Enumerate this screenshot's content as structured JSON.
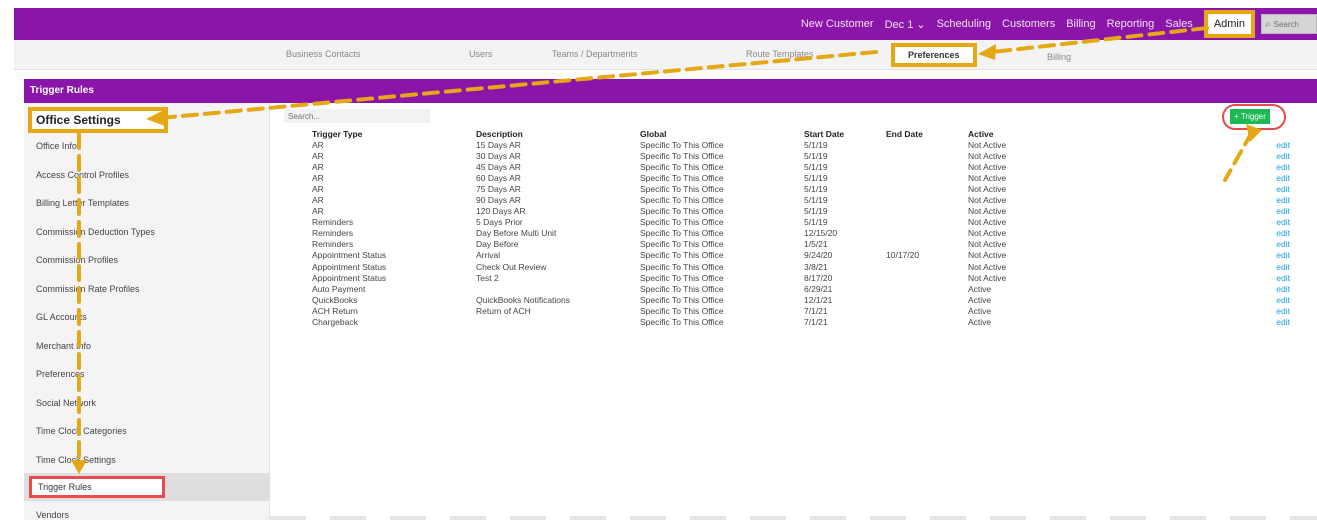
{
  "topnav": {
    "items": [
      "New Customer",
      "Dec 1 ⌄",
      "Scheduling",
      "Customers",
      "Billing",
      "Reporting",
      "Sales"
    ],
    "admin_label": "Admin",
    "search_placeholder": "Search"
  },
  "subnav": {
    "items": [
      "Business Contacts",
      "Users",
      "Teams / Departments",
      "Route Templates",
      "Billing"
    ],
    "active": "Preferences"
  },
  "panel": {
    "title": "Trigger Rules"
  },
  "sidebar": {
    "title": "Office Settings",
    "items": [
      "Office Info",
      "Access Control Profiles",
      "Billing Letter Templates",
      "Commission Deduction Types",
      "Commission Profiles",
      "Commission Rate Profiles",
      "GL Accounts",
      "Merchant Info",
      "Preferences",
      "Social Network",
      "Time Clock Categories",
      "Time Clock Settings"
    ],
    "active_item": "Trigger Rules",
    "after_item": "Vendors"
  },
  "search": {
    "placeholder": "Search..."
  },
  "add_button": {
    "label": "+ Trigger"
  },
  "table": {
    "headers": [
      "Trigger Type",
      "Description",
      "Global",
      "Start Date",
      "End Date",
      "Active"
    ],
    "edit_label": "edit",
    "rows": [
      [
        "AR",
        "15 Days AR",
        "Specific To This Office",
        "5/1/19",
        "",
        "Not Active"
      ],
      [
        "AR",
        "30 Days AR",
        "Specific To This Office",
        "5/1/19",
        "",
        "Not Active"
      ],
      [
        "AR",
        "45 Days AR",
        "Specific To This Office",
        "5/1/19",
        "",
        "Not Active"
      ],
      [
        "AR",
        "60 Days AR",
        "Specific To This Office",
        "5/1/19",
        "",
        "Not Active"
      ],
      [
        "AR",
        "75 Days AR",
        "Specific To This Office",
        "5/1/19",
        "",
        "Not Active"
      ],
      [
        "AR",
        "90 Days AR",
        "Specific To This Office",
        "5/1/19",
        "",
        "Not Active"
      ],
      [
        "AR",
        "120 Days AR",
        "Specific To This Office",
        "5/1/19",
        "",
        "Not Active"
      ],
      [
        "Reminders",
        "5 Days Prior",
        "Specific To This Office",
        "5/1/19",
        "",
        "Not Active"
      ],
      [
        "Reminders",
        "Day Before Multi Unit",
        "Specific To This Office",
        "12/15/20",
        "",
        "Not Active"
      ],
      [
        "Reminders",
        "Day Before",
        "Specific To This Office",
        "1/5/21",
        "",
        "Not Active"
      ],
      [
        "Appointment Status",
        "Arrival",
        "Specific To This Office",
        "9/24/20",
        "10/17/20",
        "Not Active"
      ],
      [
        "Appointment Status",
        "Check Out Review",
        "Specific To This Office",
        "3/8/21",
        "",
        "Not Active"
      ],
      [
        "Appointment Status",
        "Test 2",
        "Specific To This Office",
        "8/17/20",
        "",
        "Not Active"
      ],
      [
        "Auto Payment",
        "",
        "Specific To This Office",
        "6/29/21",
        "",
        "Active"
      ],
      [
        "QuickBooks",
        "QuickBooks Notifications",
        "Specific To This Office",
        "12/1/21",
        "",
        "Active"
      ],
      [
        "ACH Return",
        "Return of ACH",
        "Specific To This Office",
        "7/1/21",
        "",
        "Active"
      ],
      [
        "Chargeback",
        "",
        "Specific To This Office",
        "7/1/21",
        "",
        "Active"
      ]
    ]
  },
  "colors": {
    "brand_purple": "#8a15a8",
    "highlight_orange": "#e5a713",
    "highlight_red": "#e84b4b",
    "button_green": "#1db954",
    "link_blue": "#1a9fd8"
  }
}
